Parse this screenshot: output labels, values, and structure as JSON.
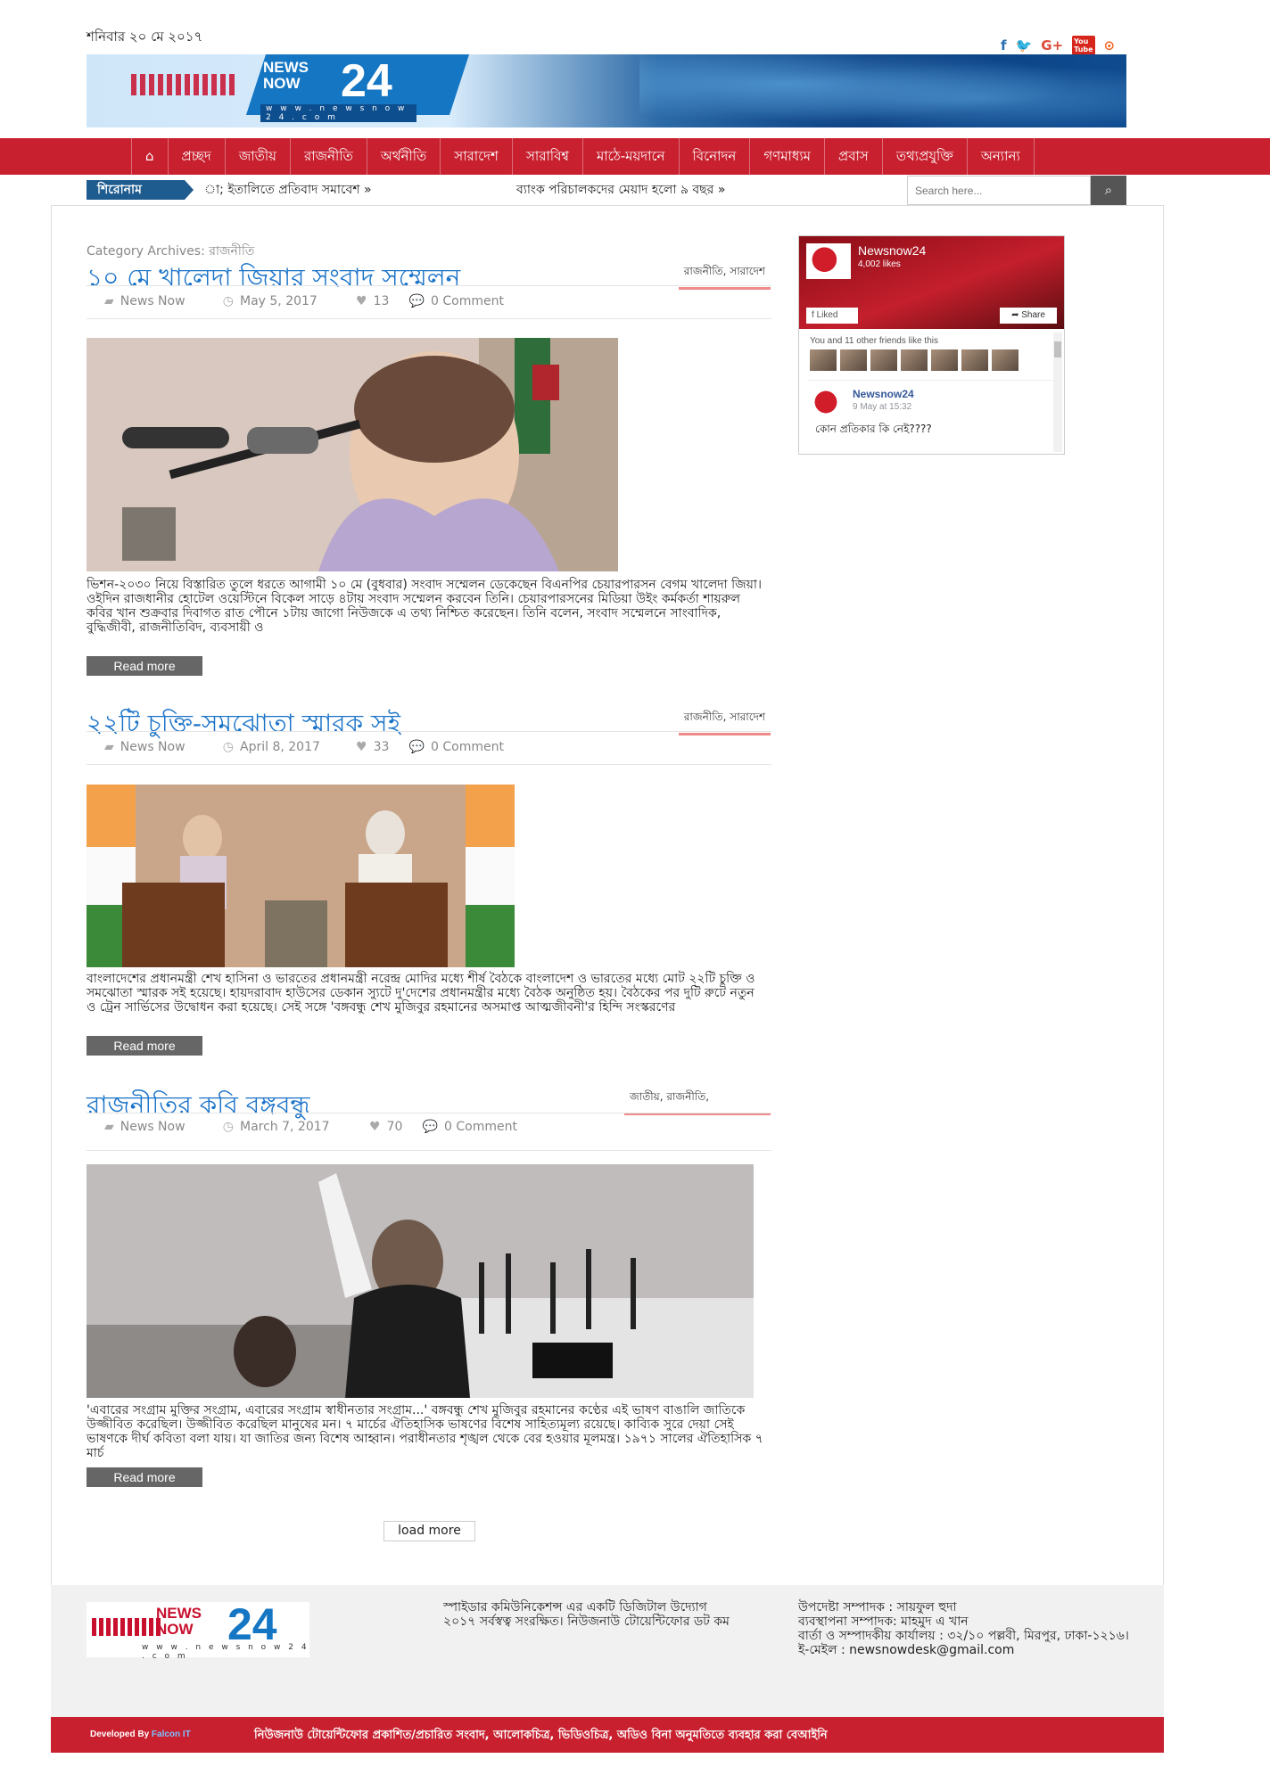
{
  "header": {
    "date": "শনিবার ২০ মে ২০১৭",
    "social": [
      "facebook-icon",
      "twitter-icon",
      "google-plus-icon",
      "youtube-icon",
      "rss-icon"
    ],
    "logo": {
      "line1": "NEWS",
      "line2": "NOW",
      "num": "24",
      "url": "w w w . n e w s n o w 2 4 . c o m"
    }
  },
  "nav": {
    "home_icon": "⌂",
    "items": [
      "প্রচ্ছদ",
      "জাতীয়",
      "রাজনীতি",
      "অর্থনীতি",
      "সারাদেশ",
      "সারাবিশ্ব",
      "মাঠে-ময়দানে",
      "বিনোদন",
      "গণমাধ্যম",
      "প্রবাস",
      "তথ্যপ্রযুক্তি",
      "অন্যান্য"
    ]
  },
  "ticker": {
    "label": "শিরোনাম",
    "items": [
      "া; ইতালিতে প্রতিবাদ সমাবেশ  »",
      "ব্যাংক পরিচালকদের মেয়াদ হলো ৯ বছর  »"
    ]
  },
  "search": {
    "placeholder": "Search here..."
  },
  "category_label": "Category Archives: রাজনীতি",
  "articles": [
    {
      "title": "১০ মে খালেদা জিয়ার সংবাদ সম্মেলন",
      "tags": "রাজনীতি, সারাদেশ",
      "author": "News Now",
      "date": "May 5, 2017",
      "likes": "13",
      "comments": "0 Comment",
      "excerpt": "ভিশন-২০৩০ নিয়ে বিস্তারিত তুলে ধরতে আগামী ১০ মে (বুধবার) সংবাদ সম্মেলন ডেকেছেন বিএনপির চেয়ারপারসন বেগম খালেদা জিয়া। ওইদিন রাজধানীর হোটেল ওয়েস্টিনে বিকেল সাড়ে ৪টায় সংবাদ সম্মেলন করবেন তিনি। চেয়ারপারসনের মিডিয়া উইং কর্মকর্তা শায়রুল কবির খান শুক্রবার দিবাগত রাত পৌনে ১টায় জাগো নিউজকে এ তথ্য নিশ্চিত করেছেন। তিনি বলেন, সংবাদ সম্মেলনে সাংবাদিক, বুদ্ধিজীবী, রাজনীতিবিদ, ব্যবসায়ী ও",
      "read_more": "Read more"
    },
    {
      "title": "২২টি চুক্তি-সমঝোতা স্মারক সই",
      "tags": "রাজনীতি, সারাদেশ",
      "author": "News Now",
      "date": "April 8, 2017",
      "likes": "33",
      "comments": "0 Comment",
      "excerpt": "বাংলাদেশের প্রধানমন্ত্রী শেখ হাসিনা ও ভারতের প্রধানমন্ত্রী নরেন্দ্র মোদির মধ্যে শীর্ষ বৈঠকে বাংলাদেশ ও ভারতের মধ্যে মোট ২২টি চুক্তি ও সমঝোতা স্মারক সই হয়েছে। হায়দরাবাদ হাউসের ডেকান স্যুটে দু'দেশের প্রধানমন্ত্রীর মধ্যে বৈঠক অনুষ্ঠিত হয়। বৈঠকের পর দুটি রুটে নতুন ও ট্রেন সার্ভিসের উদ্বোধন করা হয়েছে। সেই সঙ্গে 'বঙ্গবন্ধু শেখ মুজিবুর রহমানের অসমাপ্ত আত্মজীবনী'র হিন্দি সংস্করণের",
      "read_more": "Read more"
    },
    {
      "title": "রাজনীতির কবি বঙ্গবন্ধু",
      "tags": "জাতীয়, রাজনীতি,",
      "author": "News Now",
      "date": "March 7, 2017",
      "likes": "70",
      "comments": "0 Comment",
      "excerpt": "'এবারের সংগ্রাম মুক্তির সংগ্রাম, এবারের সংগ্রাম স্বাধীনতার সংগ্রাম...' বঙ্গবন্ধু শেখ মুজিবুর রহমানের কণ্ঠের এই ভাষণ বাঙালি জাতিকে উজ্জীবিত করেছিল। উজ্জীবিত করেছিল মানুষের মন। ৭ মার্চের ঐতিহাসিক ভাষণের বিশেষ সাহিত্যমূল্য রয়েছে। কাব্যিক সুরে দেয়া সেই ভাষণকে দীর্ঘ কবিতা বলা যায়। যা জাতির জন্য বিশেষ আহ্বান। পরাধীনতার শৃঙ্খল থেকে বের হওয়ার মূলমন্ত্র। ১৯৭১ সালের ঐতিহাসিক ৭ মার্চ",
      "read_more": "Read more"
    }
  ],
  "load_more": "load more",
  "facebook": {
    "page_name": "Newsnow24",
    "likes": "4,002 likes",
    "liked": "Liked",
    "share": "Share",
    "friends_text": "You and 11 other friends like this",
    "post_name": "Newsnow24",
    "post_date": "9 May at 15:32",
    "post_text": "কোন প্রতিকার কি নেই????"
  },
  "footer": {
    "col1": "স্পাইডার কমিউনিকেশন্স এর একটি ডিজিটাল উদ্যোগ\n২০১৭ সর্বস্বত্ব সংরক্ষিত। নিউজনাউ টোয়েন্টিফোর ডট কম",
    "col2": "উপদেষ্টা সম্পাদক : সায়ফুল হুদা\nব্যবস্থাপনা সম্পাদক: মাহমুদ এ খান\nবার্তা ও সম্পাদকীয় কার্যালয় : ৩২/১০ পল্লবী, মিরপুর, ঢাকা-১২১৬। ই-মেইল : newsnowdesk@gmail.com",
    "dev_label": "Developed By",
    "dev_name": "Falcon IT",
    "notice": "নিউজনাউ টোয়েন্টিফোর প্রকাশিত/প্রচারিত সংবাদ, আলোকচিত্র, ভিডিওচিত্র, অডিও বিনা অনুমতিতে ব্যবহার করা বেআইনি"
  }
}
